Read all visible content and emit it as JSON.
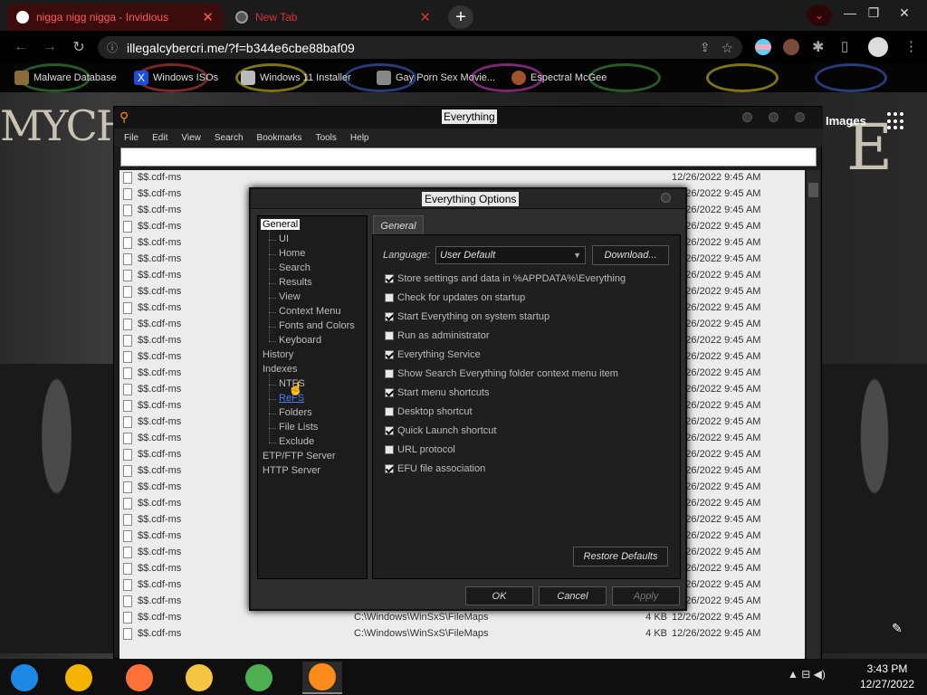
{
  "browser": {
    "tabs": [
      {
        "title": "nigga nigg nigga - Invidious",
        "close": "✕",
        "active": true
      },
      {
        "title": "New Tab",
        "close": "✕",
        "active": false
      }
    ],
    "new_tab": "+",
    "url": "illegalcybercri.me/?f=b344e6cbe88baf09",
    "window_controls": [
      "—",
      "❐",
      "✕"
    ]
  },
  "bookmarks": [
    {
      "label": "Malware Database",
      "icon": "bookmark-icon",
      "color": "#8a6d3b"
    },
    {
      "label": "Windows ISOs",
      "icon": "x-logo-icon",
      "color": "#1d4ed8"
    },
    {
      "label": "Windows 11 Installer",
      "icon": "page-icon",
      "color": "#bbbbbb"
    },
    {
      "label": "Gay Porn Sex Movie...",
      "icon": "site-icon",
      "color": "#888888"
    },
    {
      "label": "Espectral McGee",
      "icon": "avatar-icon",
      "color": "#a0522d"
    }
  ],
  "page": {
    "images_link": "Images",
    "art_text_left": "MYCHE",
    "art_text_right": "E"
  },
  "everything": {
    "title": "Everything",
    "menu": [
      "File",
      "Edit",
      "View",
      "Search",
      "Bookmarks",
      "Tools",
      "Help"
    ],
    "search_value": "",
    "rows": [
      {
        "name": "$$.cdf-ms",
        "path": "",
        "size": "",
        "date": "12/26/2022 9:45 AM"
      },
      {
        "name": "$$.cdf-ms",
        "path": "",
        "size": "",
        "date": "12/26/2022 9:45 AM"
      },
      {
        "name": "$$.cdf-ms",
        "path": "",
        "size": "",
        "date": "12/26/2022 9:45 AM"
      },
      {
        "name": "$$.cdf-ms",
        "path": "",
        "size": "",
        "date": "12/26/2022 9:45 AM"
      },
      {
        "name": "$$.cdf-ms",
        "path": "",
        "size": "",
        "date": "12/26/2022 9:45 AM"
      },
      {
        "name": "$$.cdf-ms",
        "path": "",
        "size": "",
        "date": "12/26/2022 9:45 AM"
      },
      {
        "name": "$$.cdf-ms",
        "path": "",
        "size": "",
        "date": "12/26/2022 9:45 AM"
      },
      {
        "name": "$$.cdf-ms",
        "path": "",
        "size": "",
        "date": "12/26/2022 9:45 AM"
      },
      {
        "name": "$$.cdf-ms",
        "path": "",
        "size": "",
        "date": "12/26/2022 9:45 AM"
      },
      {
        "name": "$$.cdf-ms",
        "path": "",
        "size": "",
        "date": "12/26/2022 9:45 AM"
      },
      {
        "name": "$$.cdf-ms",
        "path": "",
        "size": "",
        "date": "12/26/2022 9:45 AM"
      },
      {
        "name": "$$.cdf-ms",
        "path": "",
        "size": "",
        "date": "12/26/2022 9:45 AM"
      },
      {
        "name": "$$.cdf-ms",
        "path": "",
        "size": "",
        "date": "12/26/2022 9:45 AM"
      },
      {
        "name": "$$.cdf-ms",
        "path": "",
        "size": "",
        "date": "12/26/2022 9:45 AM"
      },
      {
        "name": "$$.cdf-ms",
        "path": "",
        "size": "",
        "date": "12/26/2022 9:45 AM"
      },
      {
        "name": "$$.cdf-ms",
        "path": "",
        "size": "",
        "date": "12/26/2022 9:45 AM"
      },
      {
        "name": "$$.cdf-ms",
        "path": "",
        "size": "",
        "date": "12/26/2022 9:45 AM"
      },
      {
        "name": "$$.cdf-ms",
        "path": "",
        "size": "",
        "date": "12/26/2022 9:45 AM"
      },
      {
        "name": "$$.cdf-ms",
        "path": "",
        "size": "",
        "date": "12/26/2022 9:45 AM"
      },
      {
        "name": "$$.cdf-ms",
        "path": "",
        "size": "",
        "date": "12/26/2022 9:45 AM"
      },
      {
        "name": "$$.cdf-ms",
        "path": "",
        "size": "",
        "date": "12/26/2022 9:45 AM"
      },
      {
        "name": "$$.cdf-ms",
        "path": "",
        "size": "",
        "date": "12/26/2022 9:45 AM"
      },
      {
        "name": "$$.cdf-ms",
        "path": "",
        "size": "",
        "date": "12/26/2022 9:45 AM"
      },
      {
        "name": "$$.cdf-ms",
        "path": "",
        "size": "",
        "date": "12/26/2022 9:45 AM"
      },
      {
        "name": "$$.cdf-ms",
        "path": "",
        "size": "",
        "date": "12/26/2022 9:45 AM"
      },
      {
        "name": "$$.cdf-ms",
        "path": "",
        "size": "",
        "date": "12/26/2022 9:45 AM"
      },
      {
        "name": "$$.cdf-ms",
        "path": "C:\\Windows\\WinSxS\\FileMaps",
        "size": "4 KB",
        "date": "12/26/2022 9:45 AM"
      },
      {
        "name": "$$.cdf-ms",
        "path": "C:\\Windows\\WinSxS\\FileMaps",
        "size": "4 KB",
        "date": "12/26/2022 9:45 AM"
      },
      {
        "name": "$$.cdf-ms",
        "path": "C:\\Windows\\WinSxS\\FileMaps",
        "size": "4 KB",
        "date": "12/26/2022 9:45 AM"
      }
    ]
  },
  "options": {
    "title": "Everything Options",
    "tree": {
      "general": "General",
      "general_children": [
        "UI",
        "Home",
        "Search",
        "Results",
        "View",
        "Context Menu",
        "Fonts and Colors",
        "Keyboard"
      ],
      "history": "History",
      "indexes": "Indexes",
      "indexes_children": [
        "NTFS",
        "ReFS",
        "Folders",
        "File Lists",
        "Exclude"
      ],
      "etp": "ETP/FTP Server",
      "http": "HTTP Server"
    },
    "tab": "General",
    "language_label": "Language:",
    "language_value": "User Default",
    "download_label": "Download...",
    "checks": [
      {
        "label": "Store settings and data in %APPDATA%\\Everything",
        "checked": true
      },
      {
        "label": "Check for updates on startup",
        "checked": false
      },
      {
        "label": "Start Everything on system startup",
        "checked": true
      },
      {
        "label": "Run as administrator",
        "checked": false
      },
      {
        "label": "Everything Service",
        "checked": true
      },
      {
        "label": "Show Search Everything folder context menu item",
        "checked": false
      },
      {
        "label": "Start menu shortcuts",
        "checked": true
      },
      {
        "label": "Desktop shortcut",
        "checked": false
      },
      {
        "label": "Quick Launch shortcut",
        "checked": true
      },
      {
        "label": "URL protocol",
        "checked": false
      },
      {
        "label": "EFU file association",
        "checked": true
      }
    ],
    "restore_label": "Restore Defaults",
    "ok_label": "OK",
    "cancel_label": "Cancel",
    "apply_label": "Apply"
  },
  "taskbar": {
    "apps": [
      {
        "name": "explorer-style-app-icon",
        "color": "#1e88e5"
      },
      {
        "name": "chrome-icon",
        "color": "#f4b400"
      },
      {
        "name": "firefox-icon",
        "color": "#ff7139"
      },
      {
        "name": "file-explorer-icon",
        "color": "#f5c542"
      },
      {
        "name": "network-app-icon",
        "color": "#4caf50"
      },
      {
        "name": "everything-search-icon",
        "color": "#ff8c1a"
      }
    ],
    "tray": "▲  ⊟  ◀)",
    "time": "3:43 PM",
    "date": "12/27/2022"
  }
}
